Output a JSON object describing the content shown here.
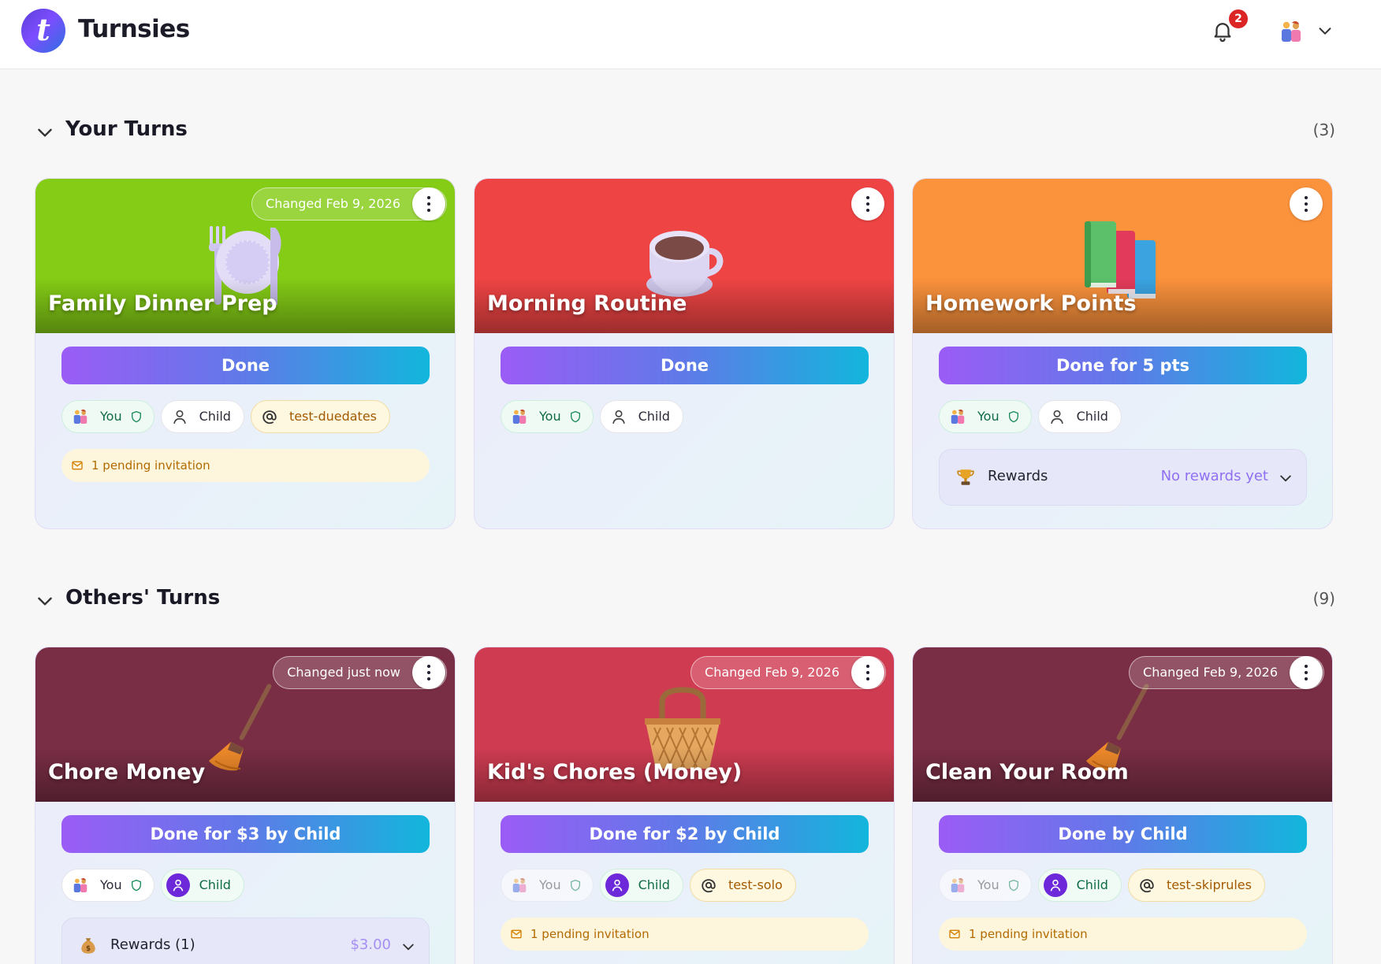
{
  "app": {
    "name": "Turnsies",
    "logo_letter": "t"
  },
  "header": {
    "notification_count": "2"
  },
  "sections": [
    {
      "title": "Your Turns",
      "count": "(3)",
      "cards": [
        {
          "name": "Family Dinner Prep",
          "changed": "Changed Feb 9, 2026",
          "done_label": "Done",
          "chips": {
            "you": "You",
            "child": "Child",
            "handle": "test-duedates"
          },
          "pending": "1 pending invitation"
        },
        {
          "name": "Morning Routine",
          "done_label": "Done",
          "chips": {
            "you": "You",
            "child": "Child"
          }
        },
        {
          "name": "Homework Points",
          "done_label": "Done for 5 pts",
          "chips": {
            "you": "You",
            "child": "Child"
          },
          "rewards": {
            "label": "Rewards",
            "value": "No rewards yet"
          }
        }
      ]
    },
    {
      "title": "Others' Turns",
      "count": "(9)",
      "cards": [
        {
          "name": "Chore Money",
          "changed": "Changed just now",
          "done_label": "Done for $3 by Child",
          "chips": {
            "you": "You",
            "child": "Child"
          },
          "rewards": {
            "label": "Rewards (1)",
            "value": "$3.00"
          }
        },
        {
          "name": "Kid's Chores (Money)",
          "changed": "Changed Feb 9, 2026",
          "done_label": "Done for $2 by Child",
          "chips": {
            "you": "You",
            "child": "Child",
            "handle": "test-solo"
          },
          "pending": "1 pending invitation"
        },
        {
          "name": "Clean Your Room",
          "changed": "Changed Feb 9, 2026",
          "done_label": "Done by Child",
          "chips": {
            "you": "You",
            "child": "Child",
            "handle": "test-skiprules"
          },
          "pending": "1 pending invitation"
        }
      ]
    }
  ],
  "colors": {
    "green_card": "#84cc16",
    "red_card": "#ef4444",
    "orange_card": "#fb923c",
    "maroon_card": "#7a2e45",
    "crimson_card": "#cf3c52",
    "button_gradient_start": "#9b5cf6",
    "button_gradient_end": "#12b6dc"
  }
}
